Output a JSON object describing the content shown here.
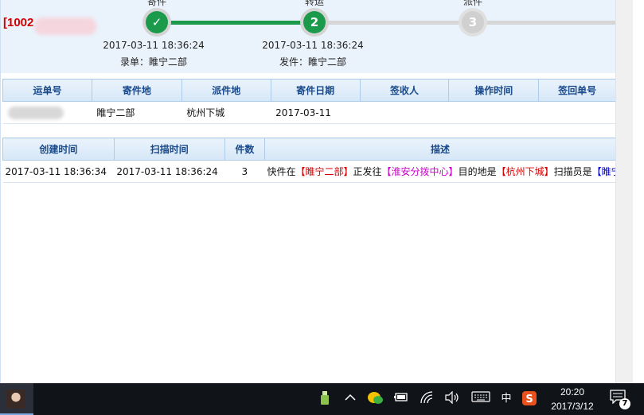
{
  "header": {
    "tracking_prefix": "[1002"
  },
  "steps": [
    {
      "label": "寄件",
      "marker": "✓",
      "time": "2017-03-11 18:36:24",
      "who": "录单：睢宁二部"
    },
    {
      "label": "转运",
      "marker": "2",
      "time": "2017-03-11 18:36:24",
      "who": "发件：睢宁二部"
    },
    {
      "label": "派件",
      "marker": "3"
    }
  ],
  "waybill_table": {
    "headers": [
      "运单号",
      "寄件地",
      "派件地",
      "寄件日期",
      "签收人",
      "操作时间",
      "签回单号"
    ],
    "row": {
      "origin": "睢宁二部",
      "destination": "杭州下城",
      "send_date": "2017-03-11"
    }
  },
  "scan_table": {
    "headers": [
      "创建时间",
      "扫描时间",
      "件数",
      "描述"
    ],
    "row": {
      "created": "2017-03-11 18:36:34",
      "scanned": "2017-03-11 18:36:24",
      "count": "3",
      "desc_1": "快件在",
      "desc_2": "【睢宁二部】",
      "desc_3": "正发往",
      "desc_4": "【淮安分拨中心】",
      "desc_5": "目的地是",
      "desc_6": "【杭州下城】",
      "desc_7": "扫描员是",
      "desc_8": "【睢宁"
    }
  },
  "taskbar": {
    "time": "20:20",
    "date": "2017/3/12",
    "ime": "中",
    "notification_count": "7",
    "colors": {
      "background": "#101318",
      "accent": "#7aa7e0"
    }
  },
  "colors": {
    "header_bg": "#eaf2fb",
    "step_done": "#1a9a4a",
    "step_todo": "#d0d0d0",
    "table_header_text": "#1a4a8a",
    "highlight_red": "#d40000",
    "highlight_magenta": "#cc00cc",
    "highlight_blue": "#0000cc"
  }
}
